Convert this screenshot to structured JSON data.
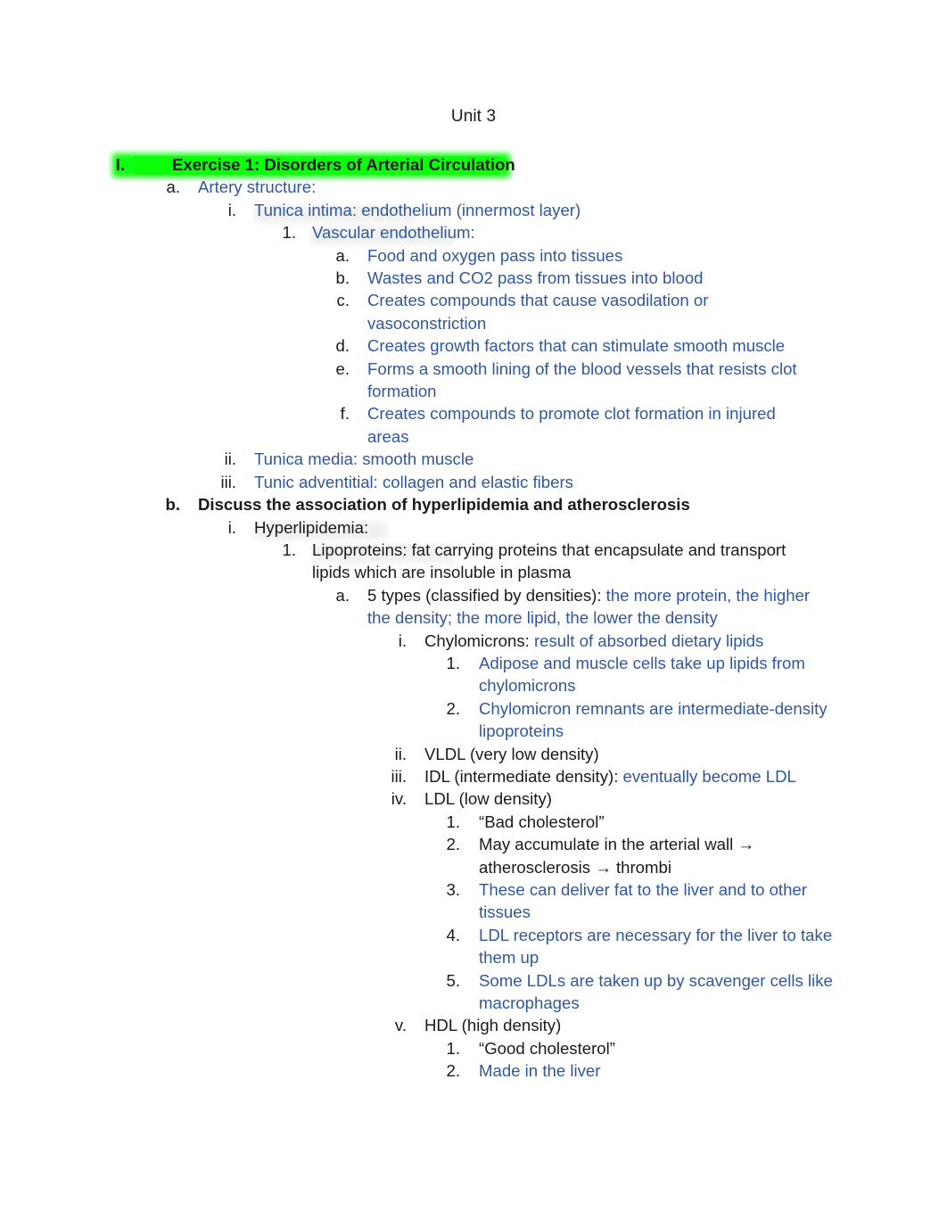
{
  "document": {
    "title": "Unit 3",
    "colors": {
      "blue_text": "#31579c",
      "black_text": "#1a1a1a",
      "highlight_green": "#00ff00",
      "page_background": "#ffffff"
    }
  },
  "outline": [
    {
      "id": "i-exercise-1",
      "level": 1,
      "marker": "I.",
      "style": "bold-black-highlighted",
      "text": "Exercise 1:  Disorders of Arterial Circulation"
    },
    {
      "id": "a-artery-structure",
      "level": 2,
      "marker": "a.",
      "style": "blue",
      "text": "Artery structure:"
    },
    {
      "id": "i-tunica-intima",
      "level": 3,
      "marker": "i.",
      "style": "blue",
      "text": "Tunica intima: endothelium (innermost layer)"
    },
    {
      "id": "1-vascular-endothelium",
      "level": 4,
      "marker": "1.",
      "style": "blue",
      "text": "Vascular endothelium:"
    },
    {
      "id": "a-food-oxygen",
      "level": 5,
      "marker": "a.",
      "style": "blue",
      "text": "Food and oxygen pass into tissues"
    },
    {
      "id": "b-wastes-co2",
      "level": 5,
      "marker": "b.",
      "style": "blue",
      "text": "Wastes and CO2 pass from tissues into blood"
    },
    {
      "id": "c-vasodilation",
      "level": 5,
      "marker": "c.",
      "style": "blue",
      "text": "Creates compounds that cause vasodilation or vasoconstriction"
    },
    {
      "id": "d-growth-factors",
      "level": 5,
      "marker": "d.",
      "style": "blue",
      "text": "Creates growth factors that can stimulate smooth muscle"
    },
    {
      "id": "e-smooth-lining",
      "level": 5,
      "marker": "e.",
      "style": "blue",
      "text": "Forms a smooth lining of the blood vessels that resists clot formation"
    },
    {
      "id": "f-promote-clot",
      "level": 5,
      "marker": "f.",
      "style": "blue",
      "text": "Creates compounds to promote clot formation in injured areas"
    },
    {
      "id": "ii-tunica-media",
      "level": 3,
      "marker": "ii.",
      "style": "blue",
      "text": "Tunica media: smooth muscle"
    },
    {
      "id": "iii-tunic-adventitial",
      "level": 3,
      "marker": "iii.",
      "style": "blue",
      "text": "Tunic adventitial: collagen and elastic fibers"
    },
    {
      "id": "b-discuss-association",
      "level": 2,
      "marker": "b.",
      "style": "bold-black",
      "text": "Discuss the association of hyperlipidemia and atherosclerosis"
    },
    {
      "id": "i-hyperlipidemia",
      "level": 3,
      "marker": "i.",
      "style": "black",
      "text": "Hyperlipidemia:"
    },
    {
      "id": "1-lipoproteins",
      "level": 4,
      "marker": "1.",
      "style": "black",
      "text": "Lipoproteins: fat carrying proteins that encapsulate and transport lipids which are insoluble in plasma"
    },
    {
      "id": "a-5-types",
      "level": 5,
      "marker": "a.",
      "style": "mixed",
      "text_black": "5 types (classified by densities): ",
      "text_blue": "the more protein, the higher the density; the more lipid, the lower the density"
    },
    {
      "id": "i-chylomicrons",
      "level": 6,
      "marker": "i.",
      "style": "mixed",
      "text_black": "Chylomicrons: ",
      "text_blue": "result of absorbed dietary lipids"
    },
    {
      "id": "1-adipose-muscle",
      "level": 7,
      "marker": "1.",
      "style": "blue",
      "text": "Adipose and muscle cells take up lipids from chylomicrons"
    },
    {
      "id": "2-chylomicron-remnants",
      "level": 7,
      "marker": "2.",
      "style": "blue",
      "text": "Chylomicron remnants are intermediate-density lipoproteins"
    },
    {
      "id": "ii-vldl",
      "level": 6,
      "marker": "ii.",
      "style": "black",
      "text": "VLDL (very low density)"
    },
    {
      "id": "iii-idl",
      "level": 6,
      "marker": "iii.",
      "style": "mixed",
      "text_black": "IDL (intermediate density): ",
      "text_blue": "eventually become LDL"
    },
    {
      "id": "iv-ldl",
      "level": 6,
      "marker": "iv.",
      "style": "black",
      "text": "LDL (low density)"
    },
    {
      "id": "1-bad-cholesterol",
      "level": 7,
      "marker": "1.",
      "style": "black",
      "text": "“Bad cholesterol”"
    },
    {
      "id": "2-may-accumulate",
      "level": 7,
      "marker": "2.",
      "style": "black",
      "text": "May accumulate in the arterial wall → atherosclerosis → thrombi"
    },
    {
      "id": "3-deliver-fat",
      "level": 7,
      "marker": "3.",
      "style": "blue",
      "text": "These can deliver fat to the liver and to other tissues"
    },
    {
      "id": "4-ldl-receptors",
      "level": 7,
      "marker": "4.",
      "style": "blue",
      "text": "LDL receptors are necessary for the liver to take them up"
    },
    {
      "id": "5-scavenger-cells",
      "level": 7,
      "marker": "5.",
      "style": "blue",
      "text": "Some LDLs are taken up by scavenger cells like macrophages"
    },
    {
      "id": "v-hdl",
      "level": 6,
      "marker": "v.",
      "style": "black",
      "text": "HDL (high density)"
    },
    {
      "id": "1-good-cholesterol",
      "level": 7,
      "marker": "1.",
      "style": "black",
      "text": "“Good cholesterol”"
    },
    {
      "id": "2-made-in-liver",
      "level": 7,
      "marker": "2.",
      "style": "blue",
      "text": "Made in the liver"
    }
  ]
}
